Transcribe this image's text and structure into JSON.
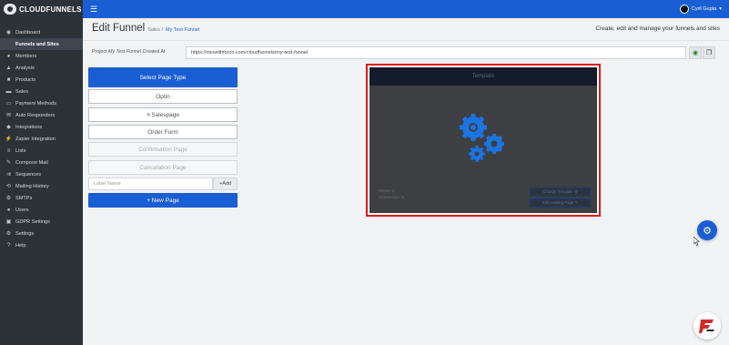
{
  "app": {
    "logo_text": "CLOUDFUNNELS"
  },
  "sidebar": {
    "items": [
      {
        "label": "Dashboard",
        "icon": "dashboard-icon",
        "glyph": "◉"
      },
      {
        "label": "Funnels and Sites",
        "icon": "funnel-icon",
        "glyph": "▼",
        "active": true
      },
      {
        "label": "Members",
        "icon": "members-icon",
        "glyph": "●"
      },
      {
        "label": "Analysis",
        "icon": "analysis-icon",
        "glyph": "▲"
      },
      {
        "label": "Products",
        "icon": "products-icon",
        "glyph": "■"
      },
      {
        "label": "Sales",
        "icon": "sales-icon",
        "glyph": "▬"
      },
      {
        "label": "Payment Methods",
        "icon": "payment-icon",
        "glyph": "▭"
      },
      {
        "label": "Auto Responders",
        "icon": "auto-responder-icon",
        "glyph": "✉"
      },
      {
        "label": "Integrations",
        "icon": "integrations-icon",
        "glyph": "◆"
      },
      {
        "label": "Zapier Integration",
        "icon": "zapier-icon",
        "glyph": "⚡"
      },
      {
        "label": "Lists",
        "icon": "lists-icon",
        "glyph": "≡"
      },
      {
        "label": "Compose Mail",
        "icon": "compose-mail-icon",
        "glyph": "✎"
      },
      {
        "label": "Sequences",
        "icon": "sequences-icon",
        "glyph": "⇉"
      },
      {
        "label": "Mailing History",
        "icon": "mailing-history-icon",
        "glyph": "⟲"
      },
      {
        "label": "SMTPs",
        "icon": "smtp-icon",
        "glyph": "⚙"
      },
      {
        "label": "Users",
        "icon": "users-icon",
        "glyph": "●"
      },
      {
        "label": "GDPR Settings",
        "icon": "gdpr-icon",
        "glyph": "▣"
      },
      {
        "label": "Settings",
        "icon": "settings-icon",
        "glyph": "⚙"
      },
      {
        "label": "Help",
        "icon": "help-icon",
        "glyph": "?"
      }
    ]
  },
  "topbar": {
    "user_name": "Cyril Gupta"
  },
  "header": {
    "title": "Edit Funnel",
    "crumb_prefix": "Sales /",
    "crumb_link": "My Test Funnel",
    "subtitle": "Create, edit and manage your funnels and sites"
  },
  "url_row": {
    "prefix": "Project",
    "project_name": "My Test Funnel",
    "suffix": "Created At",
    "url": "https://risowithforco.com/cloudfunnels/my-test-funnel"
  },
  "page_type": {
    "select_label": "Select Page Type",
    "buttons": [
      {
        "label": "Optin"
      },
      {
        "label": "Salespage"
      },
      {
        "label": "Order Form"
      },
      {
        "label": "Confirmation Page"
      },
      {
        "label": "Cancelation Page"
      }
    ],
    "label_placeholder": "Label Name",
    "add_label": "+Add",
    "new_page_label": "+ New Page"
  },
  "preview": {
    "header_text": "Template",
    "meta_line1": "Views: 0",
    "meta_line2": "Conversion: 1",
    "change_template_label": "Change Template ⚙",
    "edit_label": "Edit existing Page ✎"
  },
  "colors": {
    "accent": "#1a5ed4",
    "highlight": "#e01b1b",
    "sidebar": "#2d3238"
  }
}
